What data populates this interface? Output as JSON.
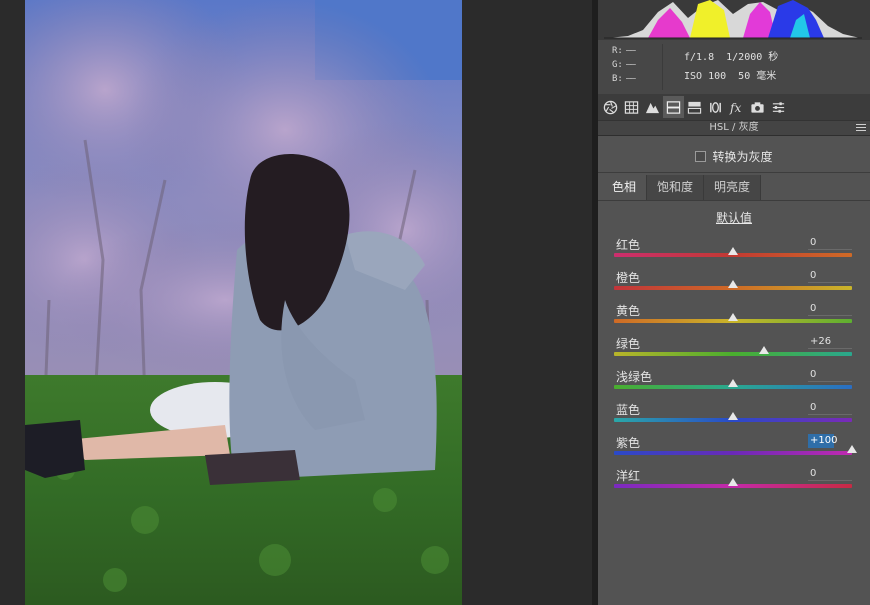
{
  "histogram": {},
  "info": {
    "rgb": [
      {
        "label": "R:",
        "value": "——"
      },
      {
        "label": "G:",
        "value": "——"
      },
      {
        "label": "B:",
        "value": "——"
      }
    ],
    "exif_line1": "f/1.8  1/2000 秒",
    "exif_line2": "ISO 100  50 毫米"
  },
  "tabs": [
    {
      "icon": "aperture-icon",
      "active": false
    },
    {
      "icon": "grid-icon",
      "active": false
    },
    {
      "icon": "mountain-icon",
      "active": false
    },
    {
      "icon": "hsl-panel-icon",
      "active": true
    },
    {
      "icon": "split-toning-icon",
      "active": false
    },
    {
      "icon": "detail-icon",
      "active": false
    },
    {
      "icon": "fx-icon",
      "active": false
    },
    {
      "icon": "camera-icon",
      "active": false
    },
    {
      "icon": "presets-sliders-icon",
      "active": false
    }
  ],
  "section": {
    "title": "HSL / 灰度"
  },
  "grayscale": {
    "label": "转换为灰度",
    "checked": false
  },
  "subtabs": [
    {
      "label": "色相",
      "active": true
    },
    {
      "label": "饱和度",
      "active": false
    },
    {
      "label": "明亮度",
      "active": false
    }
  ],
  "default_label": "默认值",
  "sliders": [
    {
      "name": "红色",
      "value": "0",
      "level": 0,
      "gradient": [
        "#cc2e6e",
        "#c23a32",
        "#cf6a26"
      ]
    },
    {
      "name": "橙色",
      "value": "0",
      "level": 0,
      "gradient": [
        "#c2343a",
        "#cf6a26",
        "#c9b52a"
      ]
    },
    {
      "name": "黄色",
      "value": "0",
      "level": 0,
      "gradient": [
        "#cf6a26",
        "#c9b52a",
        "#5db030"
      ]
    },
    {
      "name": "绿色",
      "value": "+26",
      "level": 26,
      "gradient": [
        "#b9b52a",
        "#4aae2e",
        "#2aa88e"
      ]
    },
    {
      "name": "浅绿色",
      "value": "0",
      "level": 0,
      "gradient": [
        "#4aae2e",
        "#2aa890",
        "#2a6ec4"
      ]
    },
    {
      "name": "蓝色",
      "value": "0",
      "level": 0,
      "gradient": [
        "#2aa8a8",
        "#2a4ac8",
        "#7a2ab8"
      ]
    },
    {
      "name": "紫色",
      "value": "+100",
      "level": 100,
      "editing": true,
      "gradient": [
        "#2a4ac8",
        "#6a2ab8",
        "#c02ab0"
      ]
    },
    {
      "name": "洋红",
      "value": "0",
      "level": 0,
      "gradient": [
        "#7a2ac0",
        "#c42aa8",
        "#c82a44"
      ]
    }
  ]
}
